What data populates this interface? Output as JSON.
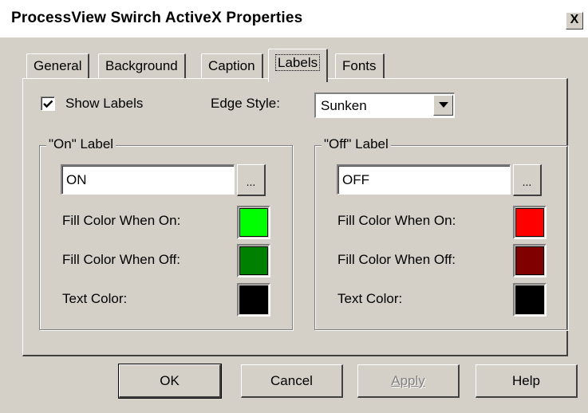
{
  "window": {
    "title": "ProcessView Swirch ActiveX Properties",
    "close_label": "X"
  },
  "tabs": [
    {
      "label": "General"
    },
    {
      "label": "Background"
    },
    {
      "label": "Caption"
    },
    {
      "label": "Labels",
      "active": true
    },
    {
      "label": "Fonts"
    }
  ],
  "labels_tab": {
    "show_labels": {
      "label": "Show Labels",
      "checked": true
    },
    "edge_style": {
      "label": "Edge Style:",
      "value": "Sunken"
    },
    "on_group": {
      "legend": "\"On\" Label",
      "text_value": "ON",
      "browse_label": "...",
      "fill_on_label": "Fill Color When On:",
      "fill_on_color": "#00ff00",
      "fill_off_label": "Fill Color When Off:",
      "fill_off_color": "#008000",
      "text_color_label": "Text Color:",
      "text_color": "#000000"
    },
    "off_group": {
      "legend": "\"Off\" Label",
      "text_value": "OFF",
      "browse_label": "...",
      "fill_on_label": "Fill Color When On:",
      "fill_on_color": "#ff0000",
      "fill_off_label": "Fill Color When Off:",
      "fill_off_color": "#800000",
      "text_color_label": "Text Color:",
      "text_color": "#000000"
    }
  },
  "buttons": {
    "ok": "OK",
    "cancel": "Cancel",
    "apply": "Apply",
    "help": "Help"
  }
}
